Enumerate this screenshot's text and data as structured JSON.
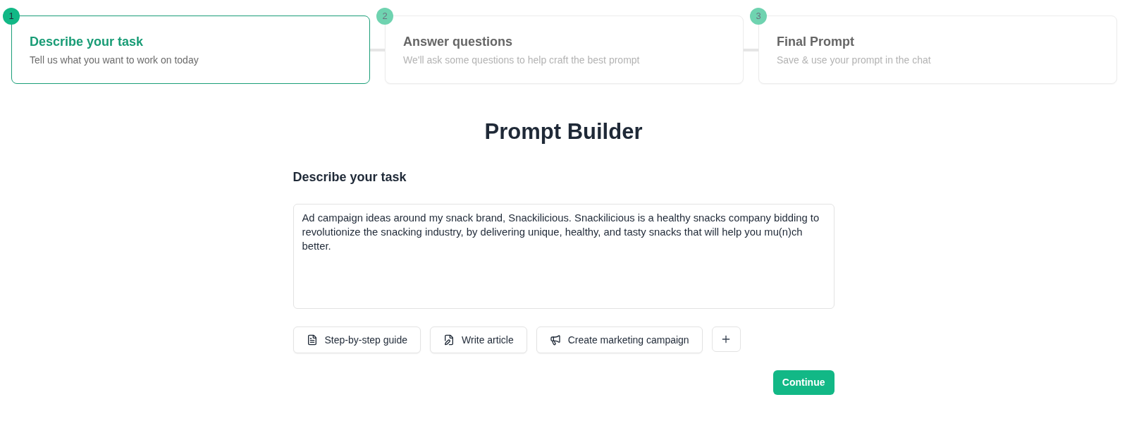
{
  "steps": [
    {
      "number": "1",
      "title": "Describe your task",
      "subtitle": "Tell us what you want to work on today",
      "selected": true
    },
    {
      "number": "2",
      "title": "Answer questions",
      "subtitle": "We'll ask some questions to help craft the best prompt",
      "selected": false
    },
    {
      "number": "3",
      "title": "Final Prompt",
      "subtitle": "Save & use your prompt in the chat",
      "selected": false
    }
  ],
  "page_title": "Prompt Builder",
  "task": {
    "heading": "Describe your task",
    "value": "Ad campaign ideas around my snack brand, Snackilicious. Snackilicious is a healthy snacks company bidding to revolutionize the snacking industry, by delivering unique, healthy, and tasty snacks that will help you mu(n)ch better."
  },
  "suggestions": [
    {
      "kind": "guide",
      "label": "Step-by-step guide"
    },
    {
      "kind": "article",
      "label": "Write article"
    },
    {
      "kind": "campaign",
      "label": "Create marketing campaign"
    }
  ],
  "continue_button": {
    "label": "Continue"
  }
}
